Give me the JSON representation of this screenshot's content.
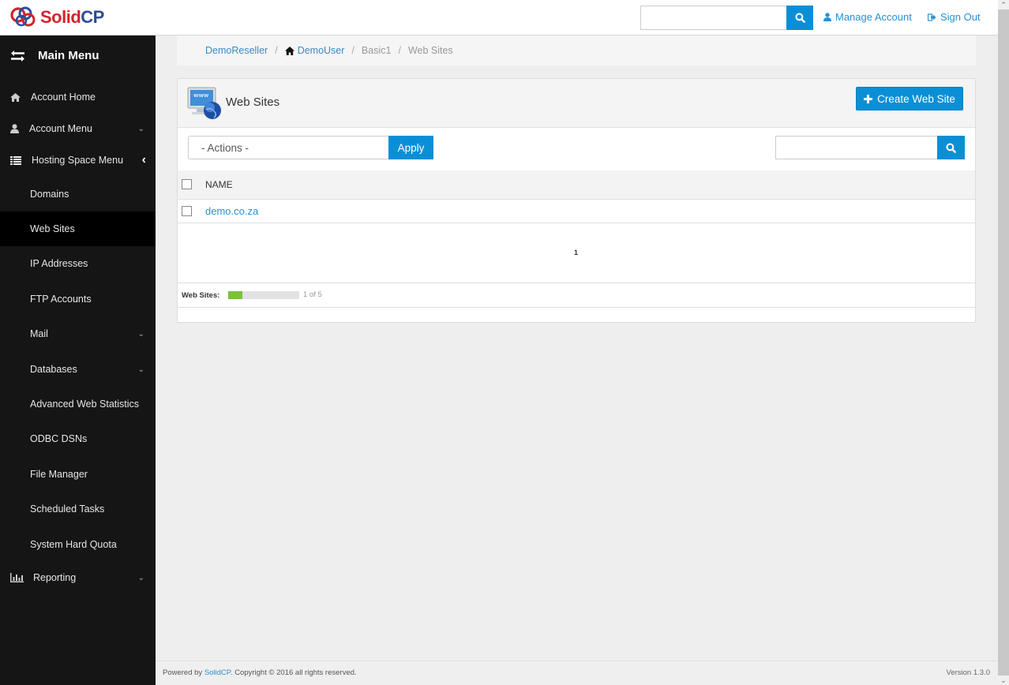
{
  "app": {
    "brand": {
      "part1": "Solid",
      "part2": "CP"
    },
    "colors": {
      "accent": "#0a8fd6",
      "link": "#2a8fd0",
      "sidebar_bg": "#151515",
      "quota_fill": "#7bbf3f"
    }
  },
  "topbar": {
    "search_value": "",
    "search_icon": "search-icon",
    "manage_account": "Manage Account",
    "sign_out": "Sign Out"
  },
  "sidebar": {
    "title": "Main Menu",
    "items": [
      {
        "label": "Account Home",
        "icon": "home-icon"
      },
      {
        "label": "Account Menu",
        "icon": "user-icon",
        "expandable": true
      },
      {
        "label": "Hosting Space Menu",
        "icon": "list-icon",
        "expanded": true
      },
      {
        "label": "Domains"
      },
      {
        "label": "Web Sites",
        "active": true
      },
      {
        "label": "IP Addresses"
      },
      {
        "label": "FTP Accounts"
      },
      {
        "label": "Mail",
        "expandable": true
      },
      {
        "label": "Databases",
        "expandable": true
      },
      {
        "label": "Advanced Web Statistics"
      },
      {
        "label": "ODBC DSNs"
      },
      {
        "label": "File Manager"
      },
      {
        "label": "Scheduled Tasks"
      },
      {
        "label": "System Hard Quota"
      },
      {
        "label": "Reporting",
        "icon": "bar-chart-icon",
        "expandable": true
      }
    ]
  },
  "breadcrumb": {
    "items": [
      "DemoReseller",
      "DemoUser",
      "Basic1",
      "Web Sites"
    ],
    "separator": "/"
  },
  "panel": {
    "title": "Web Sites",
    "create_button": "Create Web Site",
    "actions_select": "- Actions -",
    "apply_button": "Apply",
    "search_value": "",
    "grid": {
      "columns": [
        "NAME"
      ],
      "rows": [
        {
          "name": "demo.co.za",
          "checked": false
        }
      ]
    },
    "pager": {
      "current": "1"
    },
    "quota": {
      "label": "Web Sites:",
      "used": 1,
      "total": 5,
      "text": "1 of 5",
      "fraction": 0.2
    }
  },
  "footer": {
    "powered_prefix": "Powered by ",
    "powered_link": "SolidCP",
    "powered_suffix": ". Copyright © 2016 all rights reserved.",
    "version": "Version 1.3.0"
  }
}
